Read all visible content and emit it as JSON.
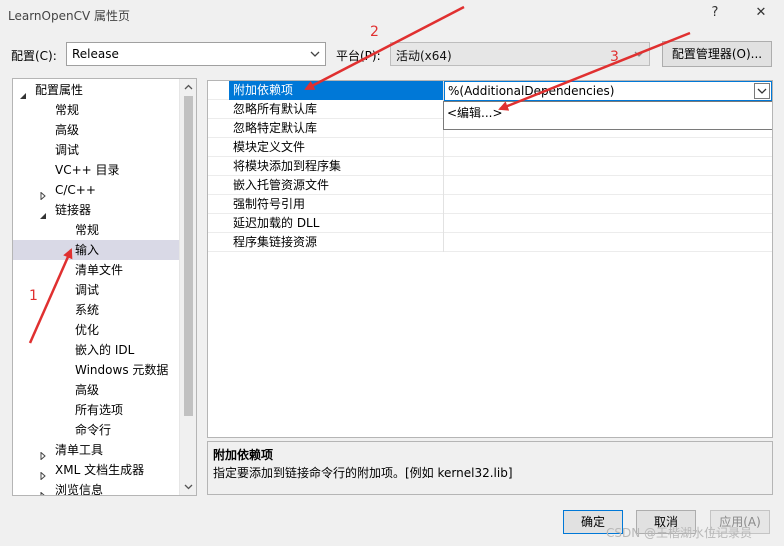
{
  "window": {
    "title": "LearnOpenCV 属性页",
    "help_glyph": "?",
    "close_glyph": "✕"
  },
  "config": {
    "label": "配置(C):",
    "value": "Release"
  },
  "platform": {
    "label": "平台(P):",
    "value": "活动(x64)"
  },
  "config_manager_label": "配置管理器(O)...",
  "tree": {
    "items": [
      {
        "label": "配置属性",
        "level": 0,
        "expander": "expanded"
      },
      {
        "label": "常规",
        "level": 1
      },
      {
        "label": "高级",
        "level": 1
      },
      {
        "label": "调试",
        "level": 1
      },
      {
        "label": "VC++ 目录",
        "level": 1
      },
      {
        "label": "C/C++",
        "level": 1,
        "expander": "collapsed"
      },
      {
        "label": "链接器",
        "level": 1,
        "expander": "expanded"
      },
      {
        "label": "常规",
        "level": 2
      },
      {
        "label": "输入",
        "level": 2,
        "selected": true
      },
      {
        "label": "清单文件",
        "level": 2
      },
      {
        "label": "调试",
        "level": 2
      },
      {
        "label": "系统",
        "level": 2
      },
      {
        "label": "优化",
        "level": 2
      },
      {
        "label": "嵌入的 IDL",
        "level": 2
      },
      {
        "label": "Windows 元数据",
        "level": 2
      },
      {
        "label": "高级",
        "level": 2
      },
      {
        "label": "所有选项",
        "level": 2
      },
      {
        "label": "命令行",
        "level": 2
      },
      {
        "label": "清单工具",
        "level": 1,
        "expander": "collapsed"
      },
      {
        "label": "XML 文档生成器",
        "level": 1,
        "expander": "collapsed"
      },
      {
        "label": "浏览信息",
        "level": 1,
        "expander": "collapsed"
      }
    ]
  },
  "grid": {
    "rows": [
      {
        "name": "附加依赖项",
        "value": "%(AdditionalDependencies)",
        "selected": true
      },
      {
        "name": "忽略所有默认库",
        "value": ""
      },
      {
        "name": "忽略特定默认库",
        "value": ""
      },
      {
        "name": "模块定义文件",
        "value": ""
      },
      {
        "name": "将模块添加到程序集",
        "value": ""
      },
      {
        "name": "嵌入托管资源文件",
        "value": ""
      },
      {
        "name": "强制符号引用",
        "value": ""
      },
      {
        "name": "延迟加载的 DLL",
        "value": ""
      },
      {
        "name": "程序集链接资源",
        "value": ""
      }
    ],
    "dropdown_item": "<编辑...>"
  },
  "description": {
    "title": "附加依赖项",
    "text": "指定要添加到链接命令行的附加项。[例如 kernel32.lib]"
  },
  "buttons": {
    "ok": "确定",
    "cancel": "取消",
    "apply": "应用(A)"
  },
  "annotations": [
    "1",
    "2",
    "3"
  ],
  "watermark": "CSDN @王楷湖水位记录员",
  "colors": {
    "selection": "#0078d7",
    "arrow": "#e03030"
  }
}
